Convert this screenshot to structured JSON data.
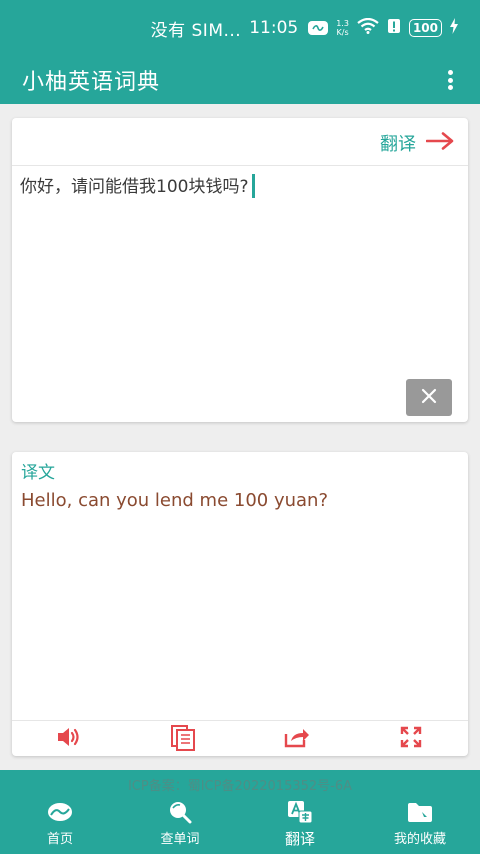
{
  "status_bar": {
    "carrier": "没有 SIM...",
    "time": "11:05",
    "speed_value": "1.3",
    "speed_unit": "K/s",
    "battery": "100"
  },
  "app_bar": {
    "title": "小柚英语词典",
    "menu_icon": "more-vert-icon"
  },
  "input_card": {
    "translate_label": "翻译",
    "source_text": "你好，请问能借我100块钱吗?",
    "clear_icon": "close-icon"
  },
  "output_card": {
    "label": "译文",
    "translated_text": "Hello, can you lend me 100 yuan?",
    "actions": [
      {
        "icon": "speaker-icon"
      },
      {
        "icon": "copy-icon"
      },
      {
        "icon": "share-icon"
      },
      {
        "icon": "fullscreen-icon"
      }
    ]
  },
  "footer": {
    "icp": "ICP备案：蜀ICP备2022015352号-6A"
  },
  "nav": {
    "items": [
      {
        "label": "首页",
        "icon": "home-icon"
      },
      {
        "label": "查单词",
        "icon": "search-icon"
      },
      {
        "label": "翻译",
        "icon": "translate-icon"
      },
      {
        "label": "我的收藏",
        "icon": "folder-icon"
      }
    ],
    "active_index": 2
  },
  "colors": {
    "primary": "#26a69a",
    "accent_red": "#e5484d",
    "output_text": "#8a4a30",
    "clear_button": "#999999"
  }
}
